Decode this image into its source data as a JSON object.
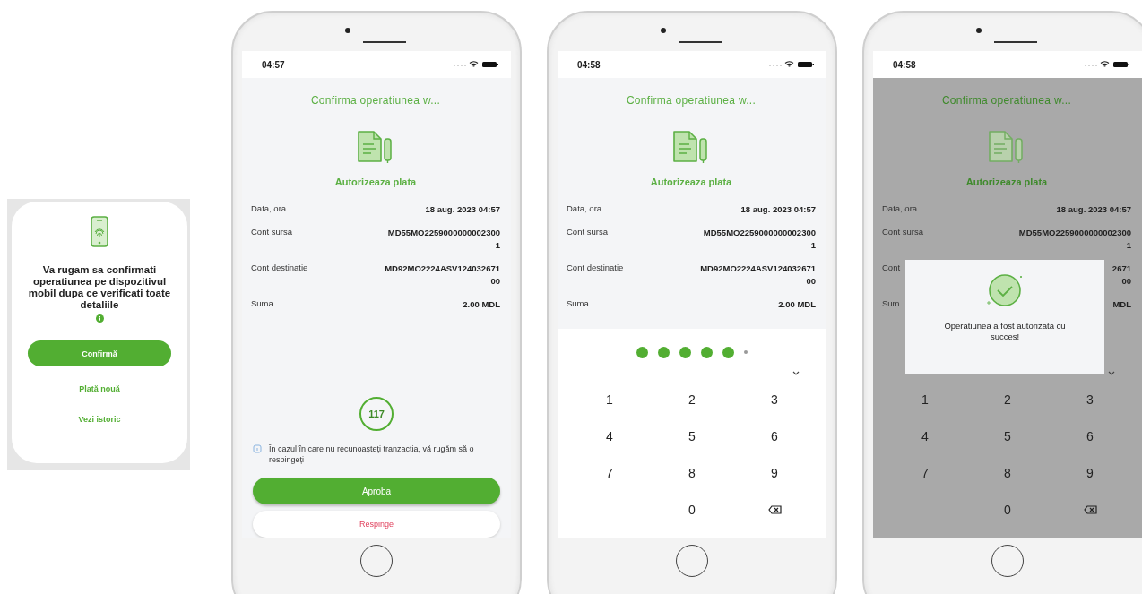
{
  "confirm_card": {
    "message": "Va rugam sa confirmati operatiunea pe dispozitivul mobil dupa ce verificati toate detaliile",
    "button": "Confirmă",
    "links": [
      "Plată nouă",
      "Vezi istoric"
    ]
  },
  "phones": [
    {
      "kind": "approve",
      "time": "04:57",
      "title": "Confirma operatiunea w...",
      "subtitle": "Autorizeaza plata",
      "dimmed": false,
      "details": [
        {
          "label": "Data, ora",
          "lines": [
            "18 aug. 2023 04:57"
          ]
        },
        {
          "label": "Cont sursa",
          "lines": [
            "MD55MO2259000000002300",
            "1"
          ]
        },
        {
          "label": "Cont destinatie",
          "lines": [
            "MD92MO2224ASV124032671",
            "00"
          ]
        },
        {
          "label": "Suma",
          "lines": [
            "2.00 MDL"
          ]
        }
      ],
      "timer": "117",
      "note": "În cazul în care nu recunoașteți tranzacția, vă rugăm să o respingeți",
      "approve": "Aproba",
      "reject": "Respinge"
    },
    {
      "kind": "pin",
      "time": "04:58",
      "title": "Confirma operatiunea w...",
      "subtitle": "Autorizeaza plata",
      "dimmed": false,
      "details": [
        {
          "label": "Data, ora",
          "lines": [
            "18 aug. 2023 04:57"
          ]
        },
        {
          "label": "Cont sursa",
          "lines": [
            "MD55MO2259000000002300",
            "1"
          ]
        },
        {
          "label": "Cont destinatie",
          "lines": [
            "MD92MO2224ASV124032671",
            "00"
          ]
        },
        {
          "label": "Suma",
          "lines": [
            "2.00 MDL"
          ]
        }
      ],
      "pin_dots": [
        {
          "filled": true
        },
        {
          "filled": true
        },
        {
          "filled": true
        },
        {
          "filled": true
        },
        {
          "filled": true
        },
        {
          "filled": false
        }
      ],
      "keys": [
        "1",
        "2",
        "3",
        "4",
        "5",
        "6",
        "7",
        "8",
        "9",
        "0"
      ]
    },
    {
      "kind": "success",
      "time": "04:58",
      "title": "Confirma operatiunea w...",
      "subtitle": "Autorizeaza plata",
      "dimmed": true,
      "details": [
        {
          "label": "Data, ora",
          "lines": [
            "18 aug. 2023 04:57"
          ]
        },
        {
          "label": "Cont sursa",
          "lines": [
            "MD55MO2259000000002300",
            "1"
          ]
        },
        {
          "label": "Cont",
          "lines": [
            "2671",
            "00"
          ]
        },
        {
          "label": "Sum",
          "lines": [
            "MDL"
          ]
        }
      ],
      "keys": [
        "1",
        "2",
        "3",
        "4",
        "5",
        "6",
        "7",
        "8",
        "9",
        "0"
      ],
      "modal": {
        "message": "Operatiunea a fost autorizata cu succes!"
      }
    }
  ]
}
